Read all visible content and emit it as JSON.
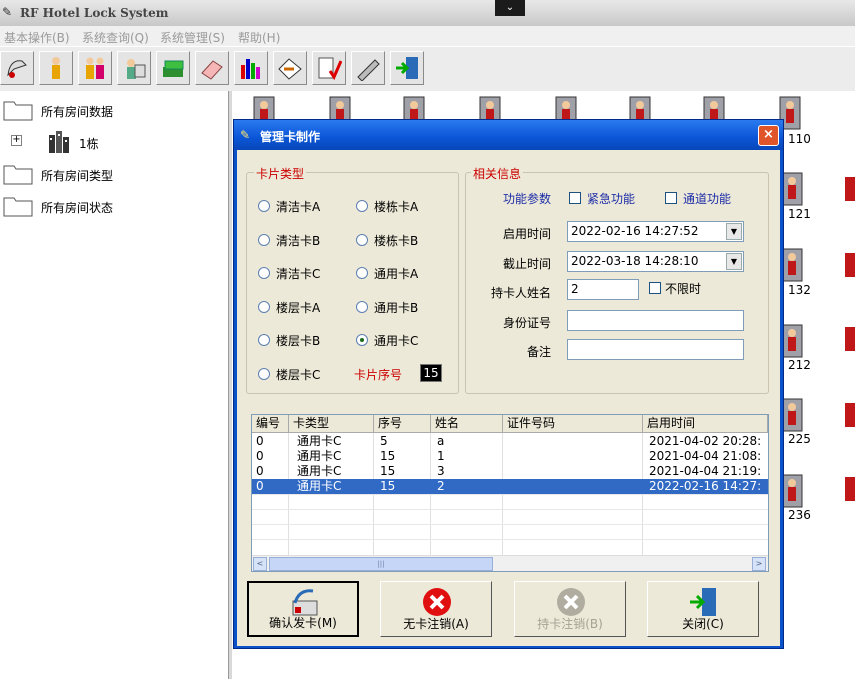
{
  "app": {
    "title": "RF Hotel Lock System",
    "dropdown_glyph": "⌄"
  },
  "menu": [
    {
      "label": "基本操作(B)"
    },
    {
      "label": "系统查询(Q)"
    },
    {
      "label": "系统管理(S)"
    },
    {
      "label": "帮助(H)"
    }
  ],
  "toolbar": {
    "icons": [
      "card-key-icon",
      "user-icon",
      "users-icon",
      "guest-card-icon",
      "stack-icon",
      "eraser-icon",
      "bar-chart-icon",
      "handshake-icon",
      "checklist-icon",
      "pen-icon",
      "exit-door-icon"
    ]
  },
  "tree": {
    "nodes": [
      {
        "label": "所有房间数据"
      },
      {
        "label": "1栋"
      },
      {
        "label": "所有房间类型"
      },
      {
        "label": "所有房间状态"
      }
    ],
    "expand_glyph": "+"
  },
  "rooms": {
    "visible_numbers": [
      "110",
      "121",
      "132",
      "212",
      "225",
      "236"
    ]
  },
  "dialog": {
    "title": "管理卡制作",
    "close_glyph": "×",
    "card_type_group": {
      "title": "卡片类型",
      "options": [
        {
          "label": "清洁卡A",
          "checked": false
        },
        {
          "label": "楼栋卡A",
          "checked": false
        },
        {
          "label": "清洁卡B",
          "checked": false
        },
        {
          "label": "楼栋卡B",
          "checked": false
        },
        {
          "label": "清洁卡C",
          "checked": false
        },
        {
          "label": "通用卡A",
          "checked": false
        },
        {
          "label": "楼层卡A",
          "checked": false
        },
        {
          "label": "通用卡B",
          "checked": false
        },
        {
          "label": "楼层卡B",
          "checked": false
        },
        {
          "label": "通用卡C",
          "checked": true
        },
        {
          "label": "楼层卡C",
          "checked": false
        }
      ],
      "serial_label": "卡片序号",
      "serial_value": "15"
    },
    "info_group": {
      "title": "相关信息",
      "func_label": "功能参数",
      "emergency_label": "紧急功能",
      "passage_label": "通道功能",
      "start_label": "启用时间",
      "start_value": "2022-02-16 14:27:52",
      "end_label": "截止时间",
      "end_value": "2022-03-18 14:28:10",
      "holder_label": "持卡人姓名",
      "holder_value": "2",
      "unlimited_label": "不限时",
      "id_label": "身份证号",
      "id_value": "",
      "note_label": "备注",
      "note_value": ""
    },
    "table": {
      "columns": [
        "编号",
        "卡类型",
        "序号",
        "姓名",
        "证件号码",
        "启用时间"
      ],
      "rows": [
        {
          "id": "0",
          "type": "通用卡C",
          "seq": "5",
          "name": "a",
          "cert": "",
          "start": "2021-04-02 20:28:",
          "selected": false
        },
        {
          "id": "0",
          "type": "通用卡C",
          "seq": "15",
          "name": "1",
          "cert": "",
          "start": "2021-04-04 21:08:",
          "selected": false
        },
        {
          "id": "0",
          "type": "通用卡C",
          "seq": "15",
          "name": "3",
          "cert": "",
          "start": "2021-04-04 21:19:",
          "selected": false
        },
        {
          "id": "0",
          "type": "通用卡C",
          "seq": "15",
          "name": "2",
          "cert": "",
          "start": "2022-02-16 14:27:",
          "selected": true
        }
      ],
      "scroll_left": "<",
      "scroll_right": ">",
      "scroll_thumb": "|||"
    },
    "buttons": {
      "issue": "确认发卡(M)",
      "cancel_no_card": "无卡注销(A)",
      "cancel_with_card": "持卡注销(B)",
      "close": "关闭(C)"
    }
  }
}
